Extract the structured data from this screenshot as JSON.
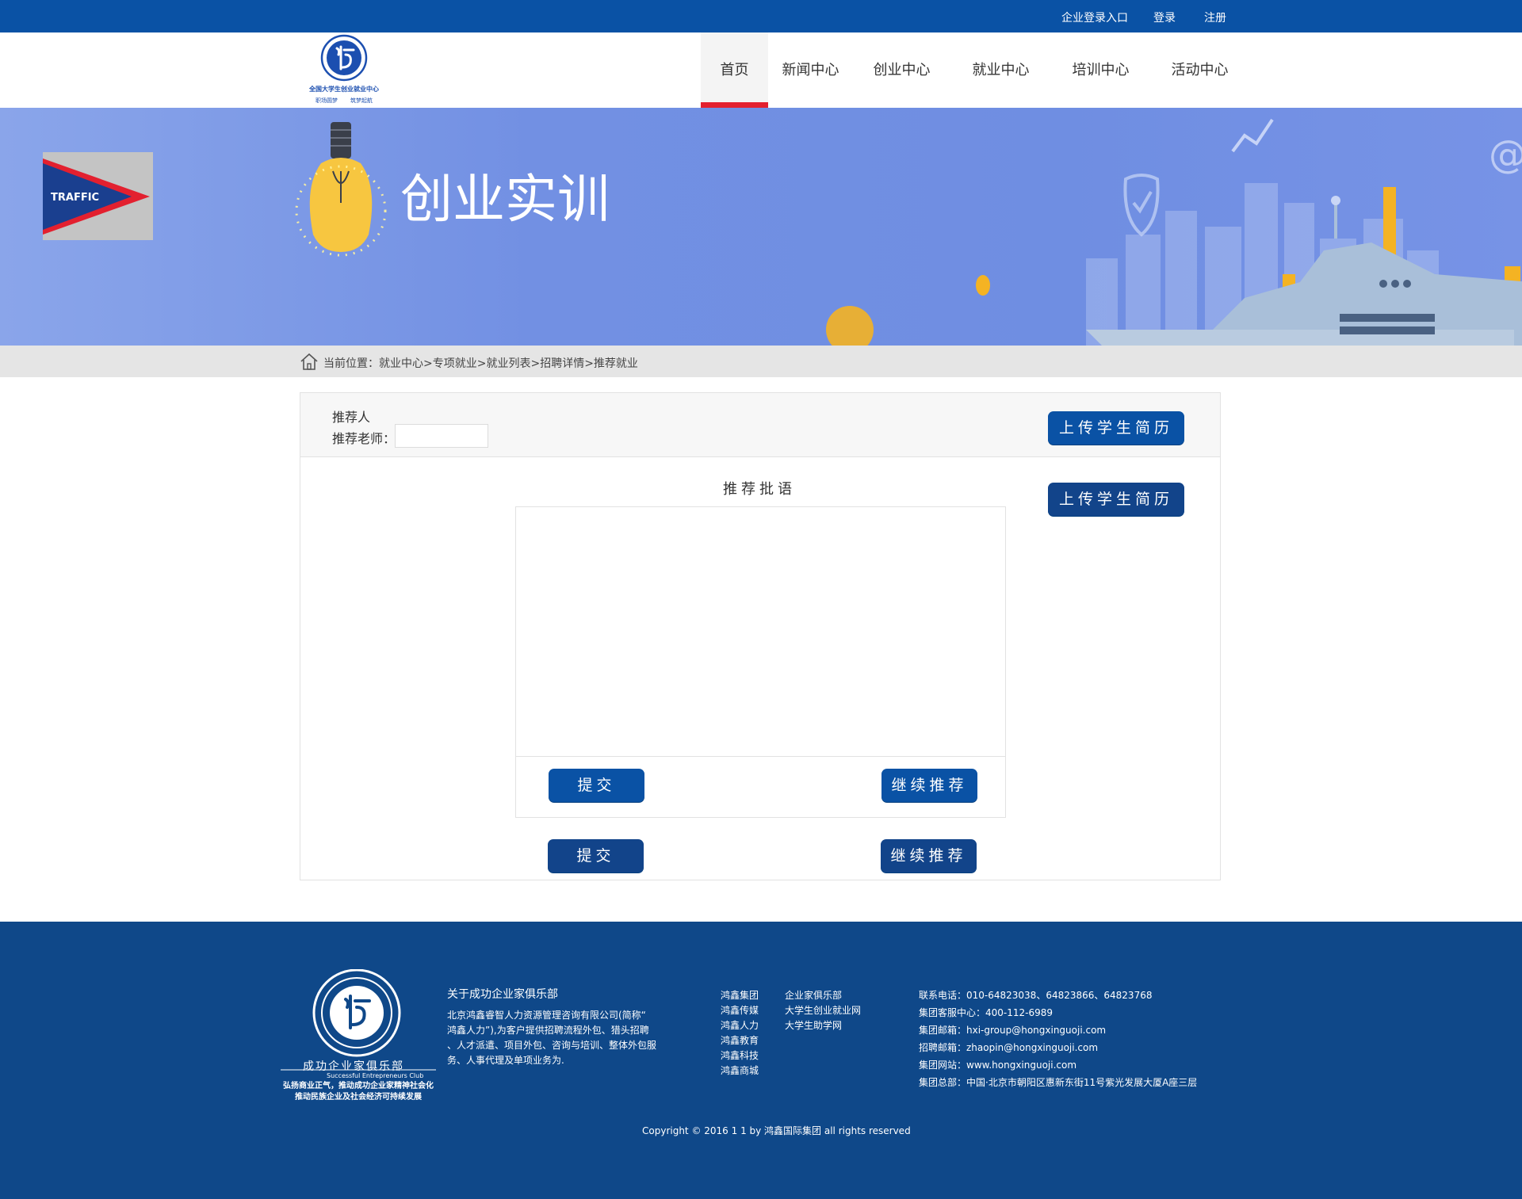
{
  "topbar": {
    "enterprise_login": "企业登录入口",
    "login": "登录",
    "register": "注册"
  },
  "logo": {
    "title": "全国大学生创业就业中心",
    "subtitle_left": "职场圆梦",
    "subtitle_right": "筑梦起航"
  },
  "nav": {
    "items": [
      {
        "label": "首页",
        "active": true
      },
      {
        "label": "新闻中心"
      },
      {
        "label": "创业中心"
      },
      {
        "label": "就业中心"
      },
      {
        "label": "培训中心"
      },
      {
        "label": "活动中心"
      }
    ]
  },
  "banner": {
    "title": "创业实训",
    "side_ad": "TRAFFIC"
  },
  "breadcrumb": {
    "text": "当前位置：就业中心>专项就业>就业列表>招聘详情>推荐就业"
  },
  "form": {
    "recommender_label": "推荐人",
    "teacher_label": "推荐老师：",
    "teacher_value": "",
    "upload_label": "上传学生简历",
    "comment_title": "推荐批语",
    "comment_value": "",
    "submit_label": "提交",
    "continue_label": "继续推荐"
  },
  "footer": {
    "club_name": "成功企业家俱乐部",
    "club_en": "Successful Entrepreneurs Club",
    "club_slogan_1": "弘扬商业正气，推动成功企业家精神社会化",
    "club_slogan_2": "推动民族企业及社会经济可持续发展",
    "about_title": "关于成功企业家俱乐部",
    "about_lines": [
      "北京鸿鑫睿智人力资源管理咨询有限公司(简称“",
      "鸿鑫人力”),为客户提供招聘流程外包、猎头招聘",
      "、人才派遣、项目外包、咨询与培训、整体外包服",
      "务、人事代理及单项业务为."
    ],
    "links_col1": [
      "鸿鑫集团",
      "鸿鑫传媒",
      "鸿鑫人力",
      "鸿鑫教育",
      "鸿鑫科技",
      "鸿鑫商城"
    ],
    "links_col2": [
      "企业家俱乐部",
      "大学生创业就业网",
      "大学生助学网"
    ],
    "contact": [
      "联系电话：010-64823038、64823866、64823768",
      "集团客服中心：400-112-6989",
      "集团邮箱：hxi-group@hongxinguoji.com",
      "招聘邮箱：zhaopin@hongxinguoji.com",
      "集团网站：www.hongxinguoji.com",
      "集团总部：中国·北京市朝阳区惠新东街11号紫光发展大厦A座三层"
    ],
    "copyright": "Copyright © 2016 1 1 by 鸿鑫国际集团 all rights reserved"
  }
}
